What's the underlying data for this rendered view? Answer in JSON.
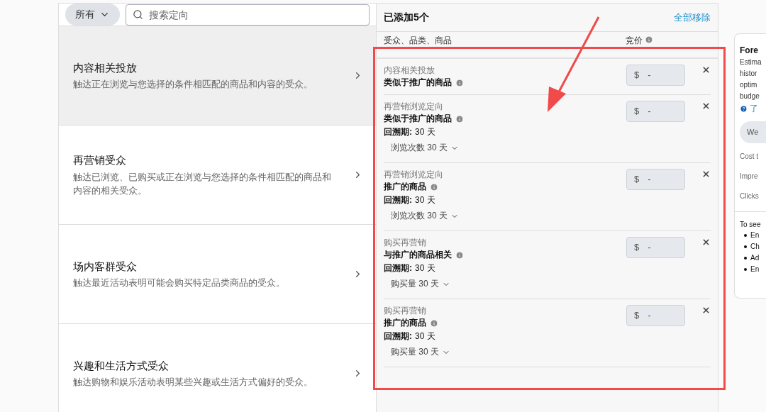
{
  "filter": {
    "label": "所有",
    "search_placeholder": "搜索定向"
  },
  "categories": [
    {
      "title": "内容相关投放",
      "description": "触达正在浏览与您选择的条件相匹配的商品和内容的受众。",
      "selected": true
    },
    {
      "title": "再营销受众",
      "description": "触达已浏览、已购买或正在浏览与您选择的条件相匹配的商品和内容的相关受众。",
      "selected": false
    },
    {
      "title": "场内客群受众",
      "description": "触达最近活动表明可能会购买特定品类商品的受众。",
      "selected": false
    },
    {
      "title": "兴趣和生活方式受众",
      "description": "触达购物和娱乐活动表明某些兴趣或生活方式偏好的受众。",
      "selected": false
    }
  ],
  "added": {
    "title": "已添加5个",
    "remove_all": "全部移除",
    "column_1": "受众、品类、商品",
    "column_2": "竞价",
    "rows": [
      {
        "category": "内容相关投放",
        "target": "类似于推广的商品",
        "bid_symbol": "$",
        "bid_value": "-"
      },
      {
        "category": "再营销浏览定向",
        "target": "类似于推广的商品",
        "lookback_label": "回溯期:",
        "lookback": "30 天",
        "dropdown": "浏览次数 30 天",
        "bid_symbol": "$",
        "bid_value": "-"
      },
      {
        "category": "再营销浏览定向",
        "target": "推广的商品",
        "lookback_label": "回溯期:",
        "lookback": "30 天",
        "dropdown": "浏览次数 30 天",
        "bid_symbol": "$",
        "bid_value": "-"
      },
      {
        "category": "购买再营销",
        "target": "与推广的商品相关",
        "lookback_label": "回溯期:",
        "lookback": "30 天",
        "dropdown": "购买量 30 天",
        "bid_symbol": "$",
        "bid_value": "-"
      },
      {
        "category": "购买再营销",
        "target": "推广的商品",
        "lookback_label": "回溯期:",
        "lookback": "30 天",
        "dropdown": "购买量 30 天",
        "bid_symbol": "$",
        "bid_value": "-"
      }
    ]
  },
  "forecast": {
    "title": "Fore",
    "description_lines": [
      "Estima",
      "histor",
      "optim",
      "budge"
    ],
    "help_link": "了",
    "tab": "We",
    "metrics": [
      "Cost t",
      "Impre",
      "Clicks"
    ],
    "note": "To see",
    "bullets": [
      "En",
      "Ch",
      "Ad",
      "En"
    ]
  }
}
